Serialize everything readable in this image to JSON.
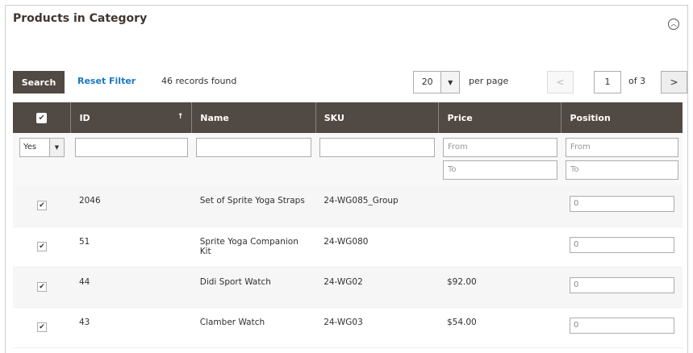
{
  "section": {
    "title": "Products in Category",
    "collapse_icon": "chevron-up-circle-icon"
  },
  "toolbar": {
    "search_label": "Search",
    "reset_label": "Reset Filter",
    "records_text": "46 records found",
    "per_page_value": "20",
    "per_page_label": "per page",
    "prev_label": "<",
    "current_page": "1",
    "of_pages": "of 3",
    "next_label": ">"
  },
  "columns": {
    "check": "✔",
    "id": "ID",
    "id_sort": "↑",
    "name": "Name",
    "sku": "SKU",
    "price": "Price",
    "position": "Position"
  },
  "filters": {
    "in_category": "Yes",
    "price_from": "From",
    "price_to": "To",
    "position_from": "From",
    "position_to": "To"
  },
  "rows": [
    {
      "checked": "✔",
      "id": "2046",
      "name": "Set of Sprite Yoga Straps",
      "sku": "24-WG085_Group",
      "price": "",
      "position": "0"
    },
    {
      "checked": "✔",
      "id": "51",
      "name": "Sprite Yoga Companion Kit",
      "sku": "24-WG080",
      "price": "",
      "position": "0"
    },
    {
      "checked": "✔",
      "id": "44",
      "name": "Didi Sport Watch",
      "sku": "24-WG02",
      "price": "$92.00",
      "position": "0"
    },
    {
      "checked": "✔",
      "id": "43",
      "name": "Clamber Watch",
      "sku": "24-WG03",
      "price": "$54.00",
      "position": "0"
    }
  ],
  "colors": {
    "header_bg": "#514943",
    "link": "#1979c3"
  }
}
